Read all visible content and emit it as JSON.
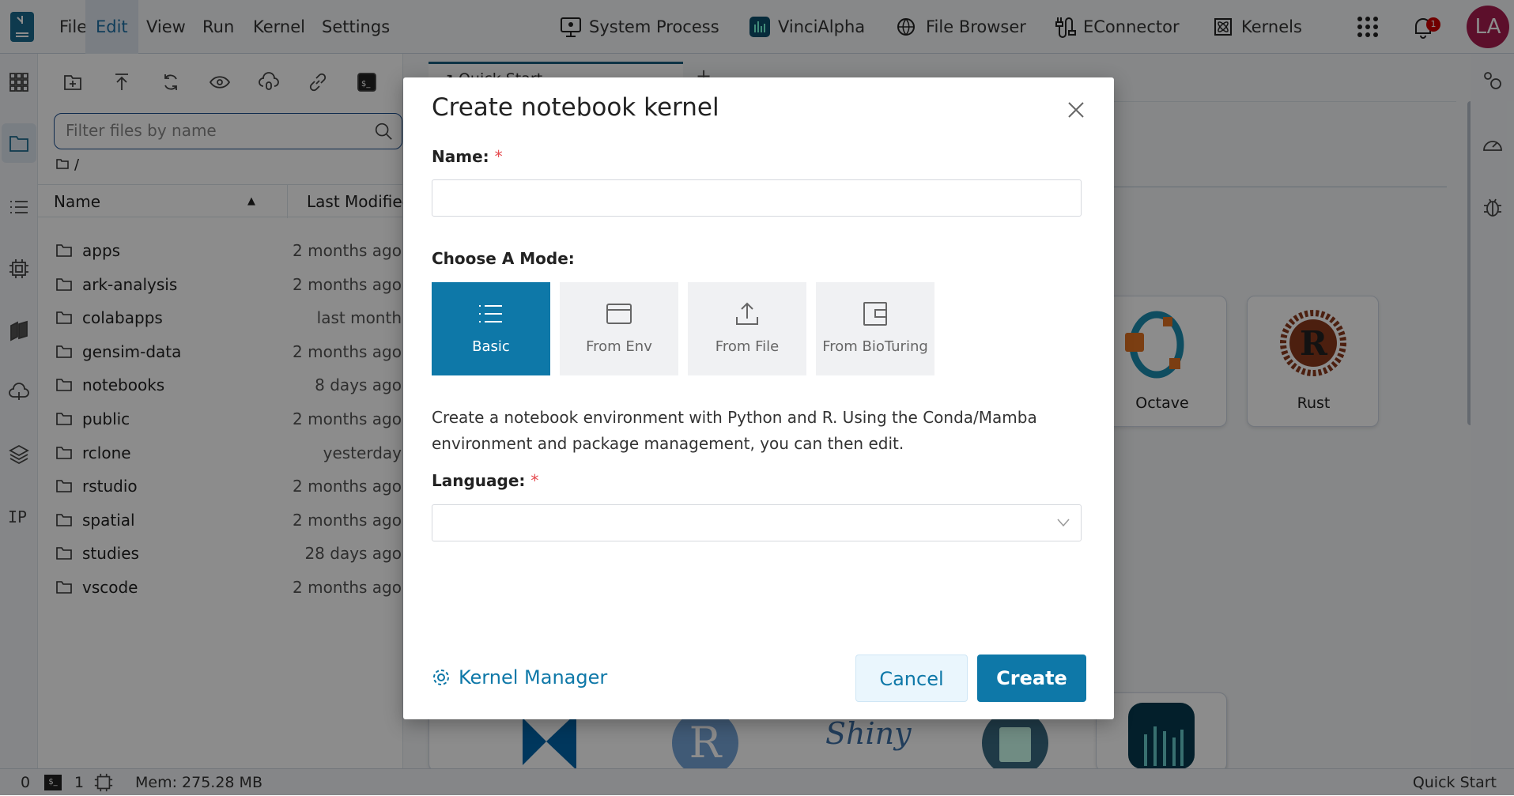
{
  "menu": [
    "File",
    "Edit",
    "View",
    "Run",
    "Kernel",
    "Settings"
  ],
  "active_menu": "Edit",
  "nav": [
    "System Process",
    "VinciAlpha",
    "File Browser",
    "EConnector",
    "Kernels"
  ],
  "notifications": "1",
  "avatar": "LA",
  "tab": "Quick Start",
  "search_placeholder": "Filter files by name",
  "breadcrumb": "/",
  "columns": {
    "name": "Name",
    "modified": "Last Modified"
  },
  "files": [
    {
      "name": "apps",
      "modified": "2 months ago"
    },
    {
      "name": "ark-analysis",
      "modified": "2 months ago"
    },
    {
      "name": "colabapps",
      "modified": "last month"
    },
    {
      "name": "gensim-data",
      "modified": "2 months ago"
    },
    {
      "name": "notebooks",
      "modified": "8 days ago"
    },
    {
      "name": "public",
      "modified": "2 months ago"
    },
    {
      "name": "rclone",
      "modified": "yesterday"
    },
    {
      "name": "rstudio",
      "modified": "2 months ago"
    },
    {
      "name": "spatial",
      "modified": "2 months ago"
    },
    {
      "name": "studies",
      "modified": "28 days ago"
    },
    {
      "name": "vscode",
      "modified": "2 months ago"
    }
  ],
  "launcher": {
    "cards": [
      "Octave",
      "Rust"
    ]
  },
  "sidebar_ip": "IP",
  "status": {
    "terminals": "0",
    "kernels": "1",
    "mem": "Mem: 275.28 MB",
    "right": "Quick Start"
  },
  "dialog": {
    "title": "Create notebook kernel",
    "name_label": "Name:",
    "name_value": "",
    "mode_label": "Choose A Mode:",
    "modes": [
      "Basic",
      "From Env",
      "From File",
      "From BioTuring"
    ],
    "selected_mode": "Basic",
    "description": "Create a notebook environment with Python and R. Using the Conda/Mamba environment and package management, you can then edit.",
    "language_label": "Language:",
    "language_value": "",
    "kernel_manager": "Kernel Manager",
    "cancel": "Cancel",
    "create": "Create",
    "required_mark": "*"
  },
  "colors": {
    "accent": "#0e78a8",
    "avatar": "#a81c4f",
    "required": "#e5484d"
  }
}
